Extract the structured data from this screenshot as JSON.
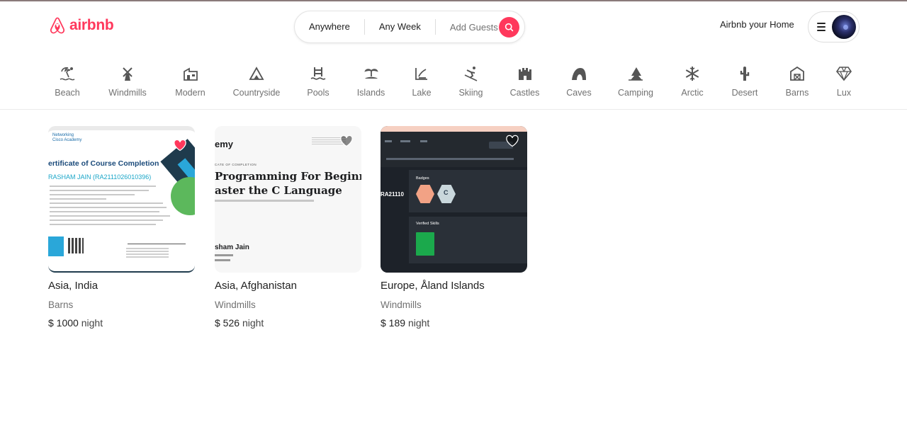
{
  "header": {
    "logo_text": "airbnb",
    "search": {
      "anywhere": "Anywhere",
      "any_week": "Any Week",
      "add_guests": "Add Guests"
    },
    "host_link": "Airbnb your Home",
    "brand_color": "#ff385c"
  },
  "categories": [
    {
      "label": "Beach",
      "icon": "beach-icon"
    },
    {
      "label": "Windmills",
      "icon": "windmill-icon"
    },
    {
      "label": "Modern",
      "icon": "modern-house-icon"
    },
    {
      "label": "Countryside",
      "icon": "countryside-icon"
    },
    {
      "label": "Pools",
      "icon": "pool-icon"
    },
    {
      "label": "Islands",
      "icon": "island-icon"
    },
    {
      "label": "Lake",
      "icon": "lake-icon"
    },
    {
      "label": "Skiing",
      "icon": "skiing-icon"
    },
    {
      "label": "Castles",
      "icon": "castle-icon"
    },
    {
      "label": "Caves",
      "icon": "cave-icon"
    },
    {
      "label": "Camping",
      "icon": "camping-icon"
    },
    {
      "label": "Arctic",
      "icon": "snowflake-icon"
    },
    {
      "label": "Desert",
      "icon": "cactus-icon"
    },
    {
      "label": "Barns",
      "icon": "barn-icon"
    },
    {
      "label": "Lux",
      "icon": "diamond-icon"
    }
  ],
  "listings": [
    {
      "location": "Asia, India",
      "category": "Barns",
      "price": "$ 1000",
      "unit": "night",
      "favorited": true,
      "image": {
        "brand": "Networking\nCisco Academy",
        "title": "ertificate of Course Completion",
        "name": "RASHAM JAIN (RA2111026010396)"
      }
    },
    {
      "location": "Asia, Afghanistan",
      "category": "Windmills",
      "price": "$ 526",
      "unit": "night",
      "favorited": false,
      "image": {
        "logo": "emy",
        "small": "CATE OF COMPLETION",
        "title_line1": "Programming For Beginner",
        "title_line2": "aster the C Language",
        "name": "sham Jain"
      }
    },
    {
      "location": "Europe, Åland Islands",
      "category": "Windmills",
      "price": "$ 189",
      "unit": "night",
      "favorited": false,
      "image": {
        "id_text": "RA21110",
        "badges_label": "Badges",
        "skills_label": "Verified Skills",
        "hex_c": "C"
      }
    }
  ]
}
